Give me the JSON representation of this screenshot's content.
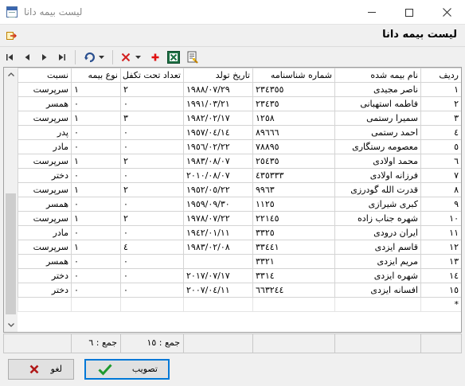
{
  "window": {
    "title": "لیست بیمه دانا"
  },
  "form": {
    "title": "لیست بیمه دانا"
  },
  "icons": {
    "toolbar": [
      "first-record-icon",
      "previous-record-icon",
      "next-record-icon",
      "last-record-icon",
      "refresh-icon",
      "chevron-down-icon",
      "delete-icon",
      "chevron-down-icon",
      "add-icon",
      "excel-icon",
      "report-icon"
    ],
    "exit": "exit-icon"
  },
  "grid": {
    "columns": [
      "ردیف",
      "نام بیمه شده",
      "شماره شناسنامه",
      "تاریخ تولد",
      "تعداد تحت تکفل",
      "نوع بیمه",
      "نسبت"
    ],
    "rows": [
      [
        "١",
        "ناصر مجیدی",
        "٢٣٤٣٥٥",
        "١٩٨٨/٠٧/٢٩",
        "٢",
        "١",
        "سرپرست"
      ],
      [
        "٢",
        "فاطمه استهبانی",
        "٢٣٤٣٥",
        "١٩٩١/٠٣/٢١",
        "٠",
        "٠",
        "همسر"
      ],
      [
        "٣",
        "سمیرا رستمی",
        "١٢٥٨",
        "١٩٨٢/٠٢/١٧",
        "٣",
        "١",
        "سرپرست"
      ],
      [
        "٤",
        "احمد رستمی",
        "٨٩٦٦٦",
        "١٩٥٧/٠٤/١٤",
        "٠",
        "٠",
        "پدر"
      ],
      [
        "٥",
        "معصومه رستگاری",
        "٧٨٨٩٥",
        "١٩٥٦/٠٢/٢٢",
        "٠",
        "٠",
        "مادر"
      ],
      [
        "٦",
        "محمد اولادی",
        "٢٥٤٣٥",
        "١٩٨٣/٠٨/٠٧",
        "٢",
        "١",
        "سرپرست"
      ],
      [
        "٧",
        "فرزانه اولادی",
        "٤٣٥٣٣٣",
        "٢٠١٠/٠٨/٠٧",
        "٠",
        "٠",
        "دختر"
      ],
      [
        "٨",
        "قدرت الله گودرزی",
        "٩٩٦٣",
        "١٩٥٢/٠٥/٢٢",
        "٢",
        "١",
        "سرپرست"
      ],
      [
        "٩",
        "کبری شیرازی",
        "١١٢٥",
        "١٩٥٩/٠٩/٣٠",
        "٠",
        "٠",
        "همسر"
      ],
      [
        "١٠",
        "شهره جناب زاده",
        "٢٢١٤٥",
        "١٩٧٨/٠٧/٢٢",
        "٢",
        "١",
        "سرپرست"
      ],
      [
        "١١",
        "ایران درودی",
        "٣٣٢٥",
        "١٩٤٢/٠١/١١",
        "٠",
        "٠",
        "مادر"
      ],
      [
        "١٢",
        "قاسم ایزدی",
        "٣٣٤٤١",
        "١٩٨٣/٠٢/٠٨",
        "٤",
        "١",
        "سرپرست"
      ],
      [
        "١٣",
        "مریم ایزدی",
        "٣٣٢١",
        "",
        "٠",
        "٠",
        "همسر"
      ],
      [
        "١٤",
        "شهره ایزدی",
        "٣٣١٤",
        "٢٠١٧/٠٧/١٧",
        "٠",
        "٠",
        "دختر"
      ],
      [
        "١٥",
        "افسانه ایزدی",
        "٦٦٣٢٤٤",
        "٢٠٠٧/٠٤/١١",
        "٠",
        "٠",
        "دختر"
      ]
    ],
    "new_row_marker": "*"
  },
  "footer": {
    "count_rows": "جمع : ١٥",
    "count_insurance": "جمع : ٦"
  },
  "buttons": {
    "ok": "تصویب",
    "cancel": "لغو"
  },
  "colors": {
    "excel": "#1d7044",
    "delete": "#d32020",
    "add": "#e01010",
    "ok_check": "#1f9a2f",
    "cancel_x": "#b01818"
  }
}
